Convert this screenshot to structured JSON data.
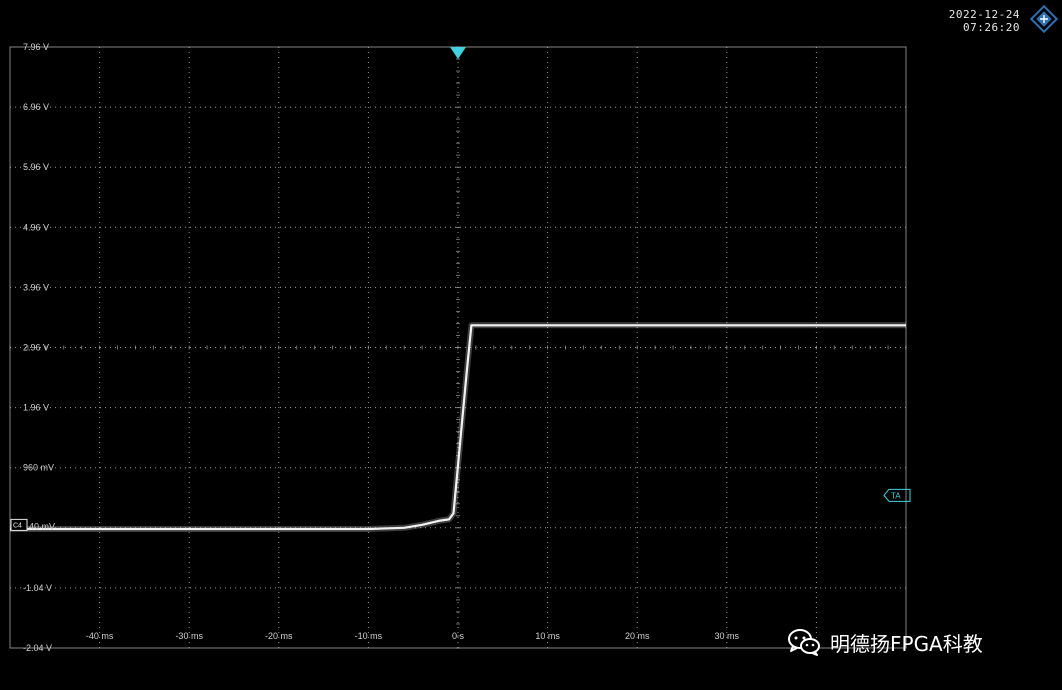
{
  "header": {
    "date": "2022-12-24",
    "time": "07:26:20"
  },
  "markers": {
    "channel_marker": "C4",
    "trigger_level_marker": "TA",
    "ground_reference_label": "40 mV"
  },
  "watermark": {
    "text": "明德扬FPGA科教",
    "icon": "wechat-icon"
  },
  "colors": {
    "background": "#000000",
    "grid": "#bdbdbd",
    "trace": "#f2f2f2",
    "trigger": "#3fd3df",
    "logo": "#2f6fb3"
  },
  "chart_data": {
    "type": "line",
    "title": "",
    "xlabel": "",
    "ylabel": "",
    "xlim": [
      -50,
      50
    ],
    "ylim": [
      -2.04,
      7.96
    ],
    "grid": true,
    "y_ticks": [
      {
        "value": 7.96,
        "label": "7.96 V"
      },
      {
        "value": 6.96,
        "label": "6.96 V"
      },
      {
        "value": 5.96,
        "label": "5.96 V"
      },
      {
        "value": 4.96,
        "label": "4.96 V"
      },
      {
        "value": 3.96,
        "label": "3.96 V"
      },
      {
        "value": 2.96,
        "label": "2.96 V"
      },
      {
        "value": 1.96,
        "label": "1.96 V"
      },
      {
        "value": 0.96,
        "label": "960 mV"
      },
      {
        "value": -1.04,
        "label": "-1.04 V"
      },
      {
        "value": -2.04,
        "label": "-2.04 V"
      }
    ],
    "x_ticks": [
      {
        "value": -40,
        "label": "-40 ms"
      },
      {
        "value": -30,
        "label": "-30 ms"
      },
      {
        "value": -20,
        "label": "-20 ms"
      },
      {
        "value": -10,
        "label": "-10 ms"
      },
      {
        "value": 0,
        "label": "0 s"
      },
      {
        "value": 10,
        "label": "10 ms"
      },
      {
        "value": 20,
        "label": "20 ms"
      },
      {
        "value": 30,
        "label": "30 ms"
      }
    ],
    "series": [
      {
        "x": [
          -50,
          -10,
          -6,
          -4,
          -2,
          -1,
          -0.5,
          0,
          1,
          1.5,
          50
        ],
        "y": [
          -0.06,
          -0.06,
          -0.04,
          0.01,
          0.08,
          0.1,
          0.2,
          1.0,
          2.6,
          3.33,
          3.33
        ]
      }
    ],
    "trigger_time": 0,
    "trigger_level": 0.5
  }
}
